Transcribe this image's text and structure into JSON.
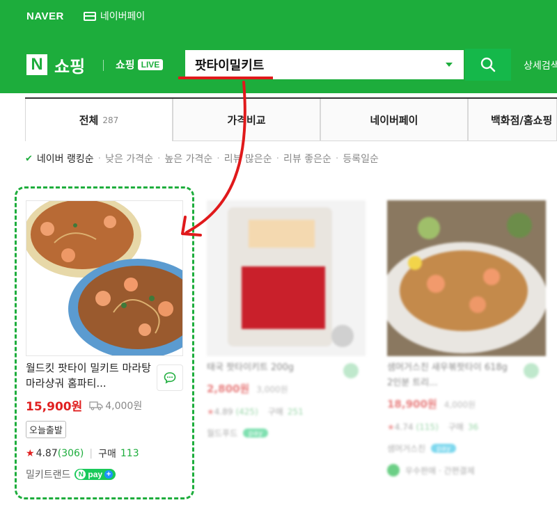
{
  "topbar": {
    "brand": "NAVER",
    "npay_link": "네이버페이"
  },
  "header": {
    "logo_letter": "N",
    "title": "쇼핑",
    "live_label": "쇼핑",
    "live_badge": "LIVE",
    "search_value": "팟타이밀키트",
    "advanced_search": "상세검색"
  },
  "tabs": [
    {
      "label": "전체",
      "count": "287"
    },
    {
      "label": "가격비교"
    },
    {
      "label": "네이버페이"
    },
    {
      "label": "백화점/홈쇼핑"
    }
  ],
  "sort": {
    "options": [
      "네이버 랭킹순",
      "낮은 가격순",
      "높은 가격순",
      "리뷰 많은순",
      "리뷰 좋은순",
      "등록일순"
    ]
  },
  "products": [
    {
      "title": "월드킷 팟타이 밀키트 마라탕 마라샹궈 홈파티...",
      "price": "15,900원",
      "shipping": "4,000원",
      "badge": "오늘출발",
      "rating": "4.87",
      "reviews": "(306)",
      "purchase_label": "구매",
      "purchases": "113",
      "seller": "밀키트랜드",
      "npay": "pay"
    },
    {
      "title": "태국 팟타이키트 200g",
      "price": "2,800원",
      "shipping": "3,000원",
      "rating": "4.89",
      "reviews": "(425)",
      "purchase_label": "구매",
      "purchases": "251",
      "seller": "월드푸드",
      "npay": "pay"
    },
    {
      "title": "샘머거스친 새우볶팟타이 618g 2인분 트리...",
      "price": "18,900원",
      "shipping": "4,000원",
      "rating": "4.74",
      "reviews": "(115)",
      "purchase_label": "구매",
      "purchases": "36",
      "seller": "샘머거스친",
      "npay": "pay",
      "extra": "우수판매 · 간편결제"
    }
  ],
  "colors": {
    "naver_green": "#1dad3c",
    "price_red": "#e02020",
    "annotation_red": "#e0191b"
  }
}
